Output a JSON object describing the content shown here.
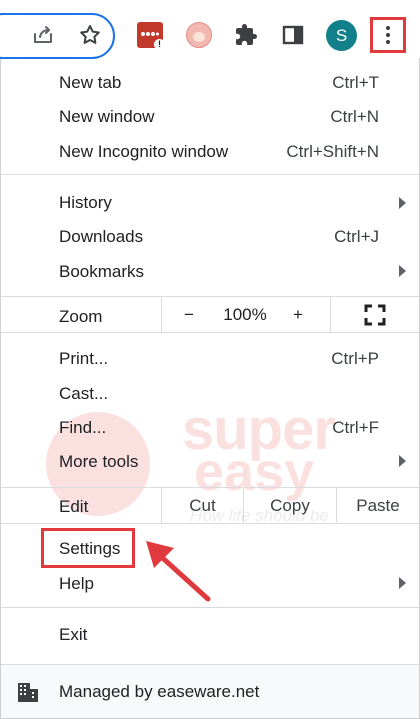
{
  "toolbar": {
    "profile_initial": "S",
    "icons": [
      "share-icon",
      "star-icon",
      "extension-red-icon",
      "extension-avatar-icon",
      "puzzle-icon",
      "side-panel-icon",
      "kebab-menu-icon"
    ],
    "highlight_color": "#e0393e",
    "omnibox_border_color": "#1a73e8",
    "profile_color": "#12808a"
  },
  "menu": {
    "new_tab": {
      "label": "New tab",
      "shortcut": "Ctrl+T"
    },
    "new_window": {
      "label": "New window",
      "shortcut": "Ctrl+N"
    },
    "new_incognito": {
      "label": "New Incognito window",
      "shortcut": "Ctrl+Shift+N"
    },
    "history": {
      "label": "History"
    },
    "downloads": {
      "label": "Downloads",
      "shortcut": "Ctrl+J"
    },
    "bookmarks": {
      "label": "Bookmarks"
    },
    "zoom": {
      "label": "Zoom",
      "minus": "−",
      "value": "100%",
      "plus": "+",
      "fullscreen_icon": "fullscreen-icon"
    },
    "print": {
      "label": "Print...",
      "shortcut": "Ctrl+P"
    },
    "cast": {
      "label": "Cast..."
    },
    "find": {
      "label": "Find...",
      "shortcut": "Ctrl+F"
    },
    "more_tools": {
      "label": "More tools"
    },
    "edit": {
      "label": "Edit",
      "cut": "Cut",
      "copy": "Copy",
      "paste": "Paste"
    },
    "settings": {
      "label": "Settings"
    },
    "help": {
      "label": "Help"
    },
    "exit": {
      "label": "Exit"
    }
  },
  "watermark": {
    "line1": "super",
    "line2": "easy",
    "tagline": "How life should be"
  },
  "footer": {
    "text": "Managed by easeware.net",
    "icon": "building-icon"
  }
}
